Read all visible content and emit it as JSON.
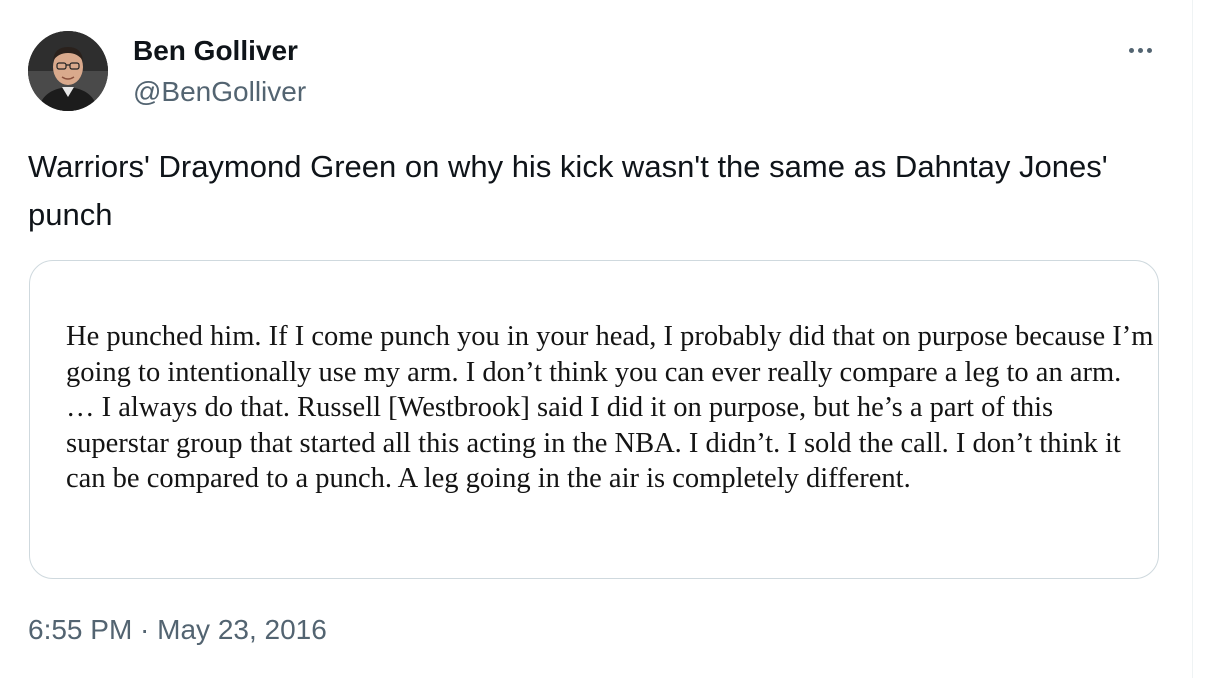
{
  "author": {
    "name": "Ben Golliver",
    "handle": "@BenGolliver"
  },
  "tweet": {
    "text": "Warriors' Draymond Green on why his kick wasn't the same as Dahntay Jones' punch",
    "media_text": "He punched him. If I come punch you in your head, I probably did that on purpose because I’m going to intentionally use my arm. I don’t think you can ever really compare a leg to an arm. … I always do that. Russell [Westbrook] said I did it on purpose, but he’s a part of this superstar group that started all this acting in the NBA. I didn’t. I sold the call. I don’t think it can be compared to a punch. A leg going in the air is completely different.",
    "timestamp": "6:55 PM · May 23, 2016"
  },
  "icons": {
    "more": "more-horizontal-icon"
  },
  "colors": {
    "text_primary": "#0f1419",
    "text_secondary": "#536471",
    "border": "#cfd9de"
  }
}
